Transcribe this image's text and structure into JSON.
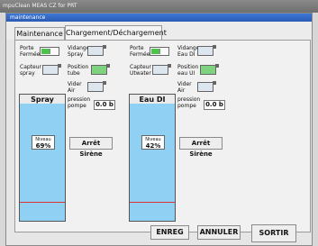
{
  "app": {
    "title": "mpuClean  MEAS CZ for PRT"
  },
  "window": {
    "title": "maintenance"
  },
  "tabs": [
    {
      "label": "Maintenance"
    },
    {
      "label": "Chargement/Déchargement"
    }
  ],
  "left": {
    "porte_label": "Porte\nFermée",
    "vidange_label": "Vidange\nSpray",
    "capteur_label": "Capteur\nspray",
    "position_label": "Position\ntube",
    "vider_label": "Vider\nAir",
    "pression_label": "pression\npompe",
    "pression_value": "0.0 b",
    "gauge_title": "Spray",
    "niveau_label": "Niveau",
    "niveau_value": "69%",
    "level_fraction": 0.69,
    "alarm_button": "Arrêt Sirène"
  },
  "right": {
    "porte_label": "Porte\nFermée",
    "vidange_label": "Vidange\nEau DI",
    "capteur_label": "Capteur\nUtwater",
    "position_label": "Position\neau UI",
    "vider_label": "Vider\nAir",
    "pression_label": "pression\npompe",
    "pression_value": "0.0 b",
    "gauge_title": "Eau DI",
    "niveau_label": "Niveau",
    "niveau_value": "42%",
    "level_fraction": 0.42,
    "alarm_button": "Arrêt Sirène"
  },
  "buttons": {
    "save": "ENREG",
    "cancel": "ANNULER",
    "exit": "SORTIR"
  },
  "colors": {
    "level_fill": "#8fd0f3",
    "toggle_on": "#4cc44c",
    "redline": "#dd3333"
  }
}
